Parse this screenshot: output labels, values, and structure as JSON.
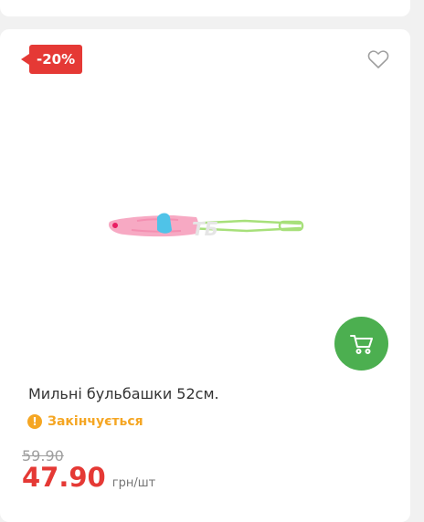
{
  "product": {
    "discount_badge": "-20%",
    "title": "Мильні бульбашки 52см.",
    "stock_status": "Закінчується",
    "old_price": "59.90",
    "price": "47.90",
    "price_unit": "грн/шт"
  },
  "icons": {
    "favorite": "heart-outline-icon",
    "cart": "cart-icon",
    "status": "exclamation-icon"
  },
  "colors": {
    "discount": "#e53935",
    "price": "#e53935",
    "cart_button": "#4caf50",
    "status": "#f5a623"
  }
}
